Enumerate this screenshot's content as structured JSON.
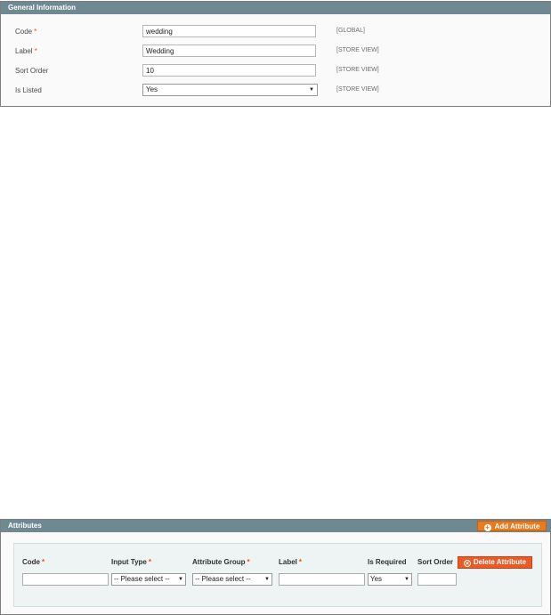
{
  "general": {
    "title": "General Information",
    "fields": [
      {
        "label": "Code",
        "required": "*",
        "value": "wedding",
        "scope": "[GLOBAL]"
      },
      {
        "label": "Label",
        "required": "*",
        "value": "Wedding",
        "scope": "[STORE VIEW]"
      },
      {
        "label": "Sort Order",
        "required": "",
        "value": "10",
        "scope": "[STORE VIEW]"
      },
      {
        "label": "Is Listed",
        "required": "",
        "value": "Yes",
        "scope": "[STORE VIEW]"
      }
    ]
  },
  "attributes": {
    "title": "Attributes",
    "add_label": "Add Attribute",
    "delete_label": "Delete Attribute",
    "columns": [
      {
        "label": "Code",
        "required": "*"
      },
      {
        "label": "Input Type",
        "required": "*"
      },
      {
        "label": "Attribute Group",
        "required": "*"
      },
      {
        "label": "Label",
        "required": "*"
      },
      {
        "label": "Is Required",
        "required": ""
      },
      {
        "label": "Sort Order",
        "required": ""
      }
    ],
    "row": {
      "code": "",
      "input_type": "-- Please select --",
      "attribute_group": "-- Please select --",
      "label": "",
      "is_required": "Yes",
      "sort_order": ""
    }
  },
  "icons": {
    "add": "plus-circle-icon",
    "delete": "remove-circle-icon",
    "dropdown": "dropdown-arrow-icon"
  },
  "colors": {
    "header_bg": "#6f8992",
    "add_button": "#eb7a1c",
    "delete_button": "#eb5a24",
    "required": "#eb5202"
  }
}
